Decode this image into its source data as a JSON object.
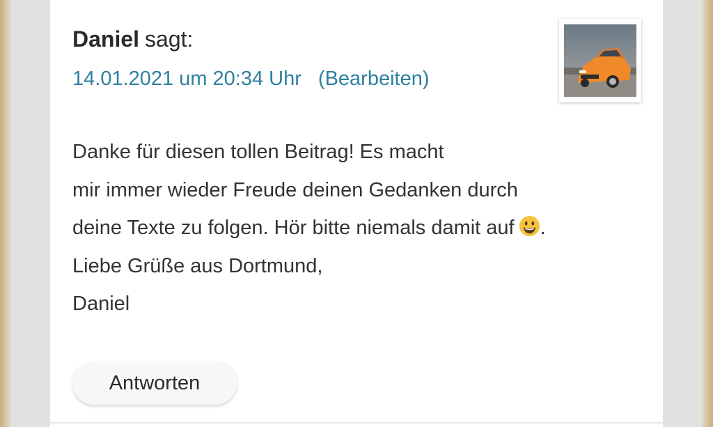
{
  "comment": {
    "author": "Daniel",
    "says": "sagt:",
    "date": "14.01.2021 um 20:34 Uhr",
    "edit_label": "(Bearbeiten)",
    "avatar_icon": "avatar-photo-orange-car",
    "body_lines": [
      "Danke für diesen tollen Beitrag! Es macht",
      "mir immer wieder Freude deinen Gedanken durch",
      "deine Texte zu folgen. Hör bitte niemals damit auf",
      "Liebe Grüße aus Dortmund,",
      "Daniel"
    ],
    "line3_suffix": ".",
    "emoji_icon": "grinning-face-emoji",
    "reply_label": "Antworten"
  },
  "colors": {
    "link": "#2f7fa0",
    "text": "#333333",
    "card_bg": "#ffffff",
    "page_bg": "#e1e1e1"
  }
}
